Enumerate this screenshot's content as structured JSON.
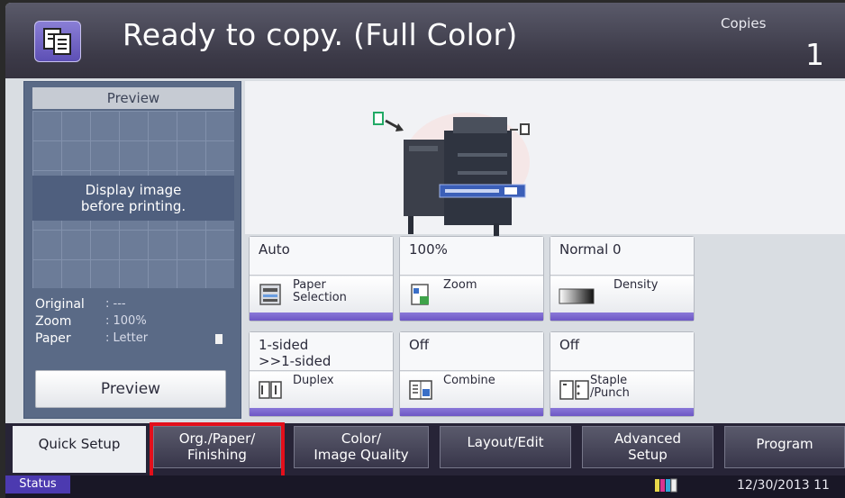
{
  "header": {
    "title": "Ready to copy. (Full Color)",
    "copies_label": "Copies",
    "copies_value": "1",
    "icon": "copy-documents-icon"
  },
  "preview": {
    "title": "Preview",
    "message_line1": "Display image",
    "message_line2": "before printing.",
    "info": [
      {
        "label": "Original",
        "value": ": ---"
      },
      {
        "label": "Zoom",
        "value": ": 100%"
      },
      {
        "label": "Paper",
        "value": ": Letter"
      }
    ],
    "button_label": "Preview"
  },
  "function_keys": [
    {
      "value": "Auto",
      "label_line1": "Paper",
      "label_line2": "Selection",
      "icon": "paper-tray-icon"
    },
    {
      "value": "100%",
      "label_line1": "Zoom",
      "label_line2": "",
      "icon": "zoom-icon"
    },
    {
      "value": "Normal 0",
      "label_line1": "Density",
      "label_line2": "",
      "icon": "density-gradient-icon"
    },
    {
      "value": "1-sided\n>>1-sided",
      "value_line1": "1-sided",
      "value_line2": ">>1-sided",
      "label_line1": "Duplex",
      "label_line2": "",
      "icon": "duplex-icon"
    },
    {
      "value": "Off",
      "label_line1": "Combine",
      "label_line2": "",
      "icon": "combine-icon"
    },
    {
      "value": "Off",
      "label_line1": "Staple",
      "label_line2": "/Punch",
      "icon": "staple-punch-icon"
    }
  ],
  "tabs": [
    {
      "line1": "Quick Setup",
      "line2": "",
      "active": true
    },
    {
      "line1": "Org./Paper/",
      "line2": "Finishing",
      "active": false,
      "highlighted": true
    },
    {
      "line1": "Color/",
      "line2": "Image Quality",
      "active": false
    },
    {
      "line1": "Layout/Edit",
      "line2": "",
      "active": false
    },
    {
      "line1": "Advanced",
      "line2": "Setup",
      "active": false
    },
    {
      "line1": "Program",
      "line2": "",
      "active": false
    }
  ],
  "status": {
    "button_label": "Status",
    "datetime": "12/30/2013 11",
    "toner_icon": "toner-levels-icon"
  },
  "colors": {
    "accent_purple": "#6d57c5",
    "header_bg": "#3c3a48",
    "highlight_red": "#e30f1b"
  }
}
